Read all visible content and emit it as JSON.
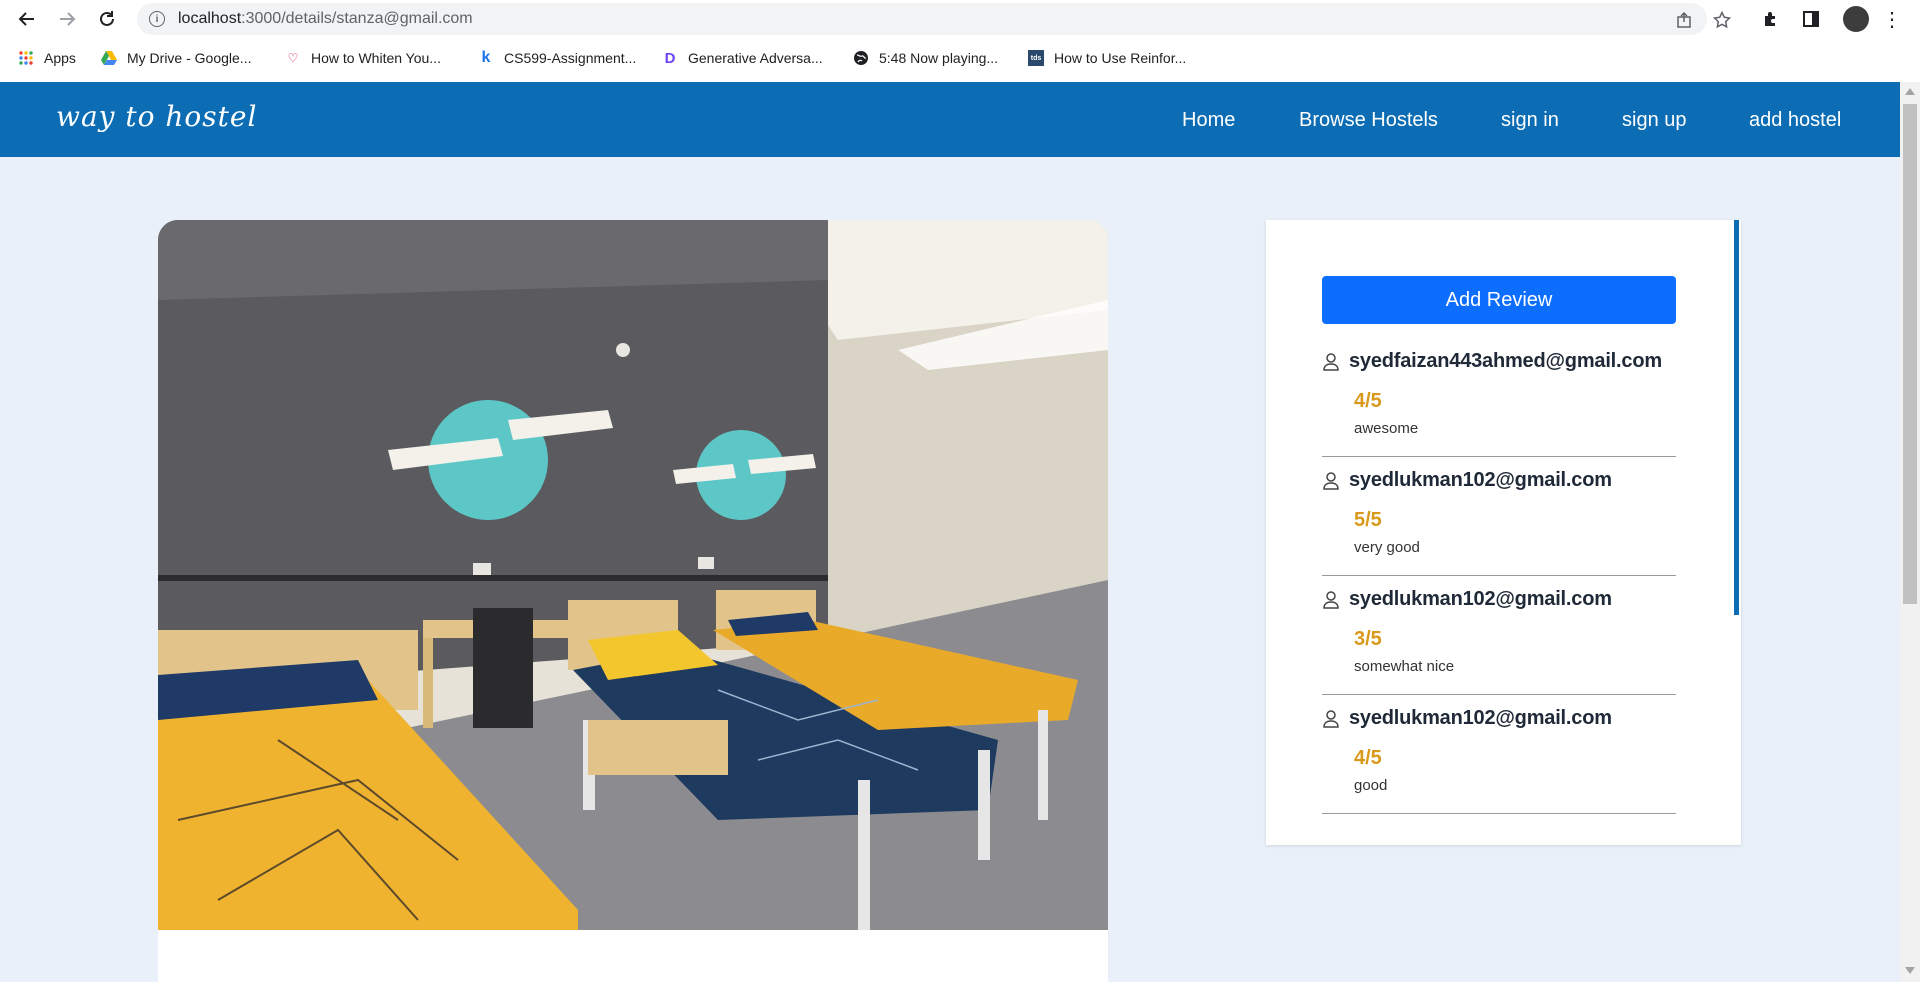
{
  "browser": {
    "url_host": "localhost",
    "url_rest": ":3000/details/stanza@gmail.com",
    "bookmarks": [
      {
        "icon": "apps-grid-icon",
        "label": "Apps"
      },
      {
        "icon": "google-drive-icon",
        "label": "My Drive - Google..."
      },
      {
        "icon": "tooth-icon",
        "label": "How to Whiten You..."
      },
      {
        "icon": "k-icon",
        "label": "CS599-Assignment..."
      },
      {
        "icon": "d-logo-icon",
        "label": "Generative Adversa..."
      },
      {
        "icon": "globe-icon",
        "label": "5:48 Now playing..."
      },
      {
        "icon": "tds-icon",
        "label": "How to Use Reinfor..."
      }
    ],
    "bookmark_tds_text": "tds"
  },
  "navbar": {
    "brand": "way to hostel",
    "links": [
      "Home",
      "Browse Hostels",
      "sign in",
      "sign up",
      "add hostel"
    ]
  },
  "hostel": {
    "photo_alt": "hostel-room-photo"
  },
  "reviews": {
    "add_button": "Add Review",
    "items": [
      {
        "user": "syedfaizan443ahmed@gmail.com",
        "rating": "4/5",
        "text": "awesome"
      },
      {
        "user": "syedlukman102@gmail.com",
        "rating": "5/5",
        "text": "very good"
      },
      {
        "user": "syedlukman102@gmail.com",
        "rating": "3/5",
        "text": "somewhat nice"
      },
      {
        "user": "syedlukman102@gmail.com",
        "rating": "4/5",
        "text": "good"
      }
    ]
  },
  "colors": {
    "navbar": "#0c6db5",
    "page_bg": "#e9f0f9",
    "button": "#0d6efd",
    "rating": "#d99a1c"
  }
}
